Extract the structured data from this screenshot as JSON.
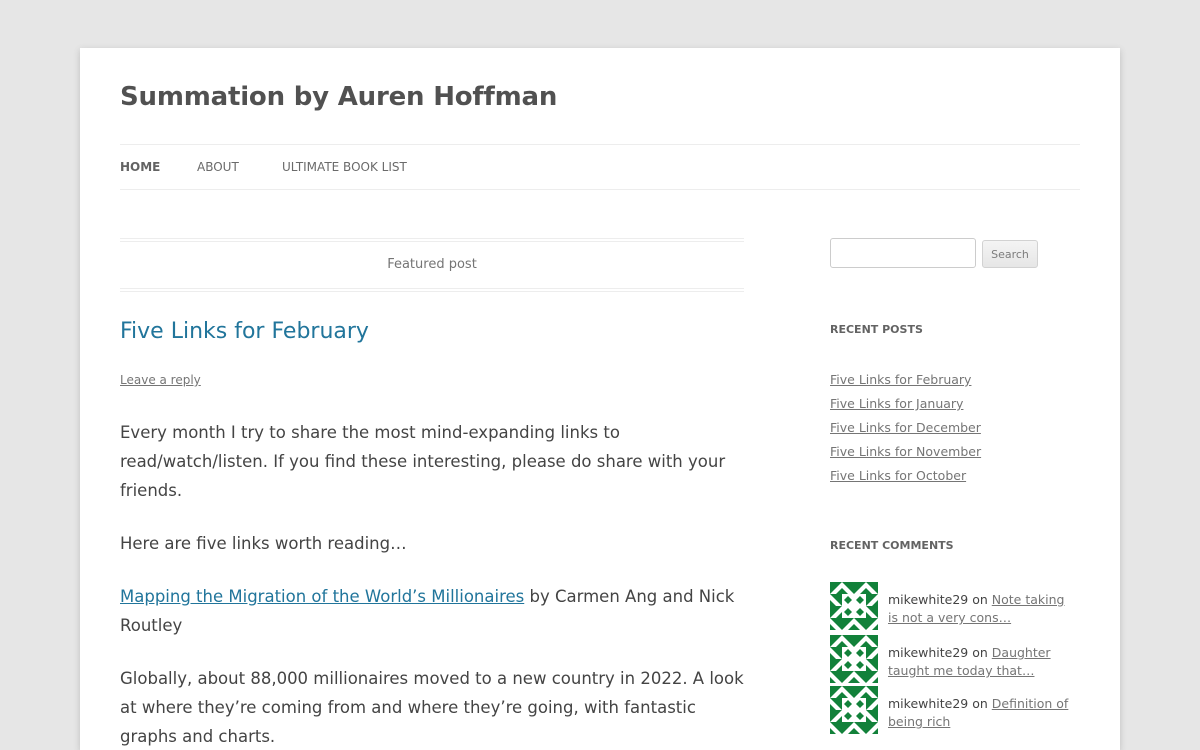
{
  "site": {
    "title": "Summation by Auren Hoffman"
  },
  "nav": {
    "items": [
      {
        "label": "Home"
      },
      {
        "label": "About"
      },
      {
        "label": "Ultimate Book List"
      }
    ]
  },
  "featured": {
    "label": "Featured post"
  },
  "post": {
    "title": "Five Links for February",
    "reply_label": "Leave a reply",
    "paragraph_1": "Every month I try to share the most mind-expanding links to read/watch/listen. If you find these interesting, please do share with your friends.",
    "paragraph_2": "Here are five links worth reading…",
    "link_1_title": "Mapping the Migration of the World’s Millionaires",
    "link_1_byline": " by Carmen Ang and Nick Routley",
    "paragraph_3": "Globally, about 88,000 millionaires moved to a new country in 2022. A look at where they’re coming from and where they’re going, with fantastic graphs and charts."
  },
  "sidebar": {
    "search": {
      "placeholder": "",
      "button_label": "Search"
    },
    "recent_posts": {
      "title": "Recent Posts",
      "items": [
        "Five Links for February",
        "Five Links for January",
        "Five Links for December",
        "Five Links for November",
        "Five Links for October"
      ]
    },
    "recent_comments": {
      "title": "Recent Comments",
      "items": [
        {
          "author": "mikewhite29",
          "on": " on ",
          "post": "Note taking is not a very cons…"
        },
        {
          "author": "mikewhite29",
          "on": " on ",
          "post": "Daughter taught me today that…"
        },
        {
          "author": "mikewhite29",
          "on": " on ",
          "post": "Definition of being rich"
        }
      ]
    }
  },
  "colors": {
    "background": "#e6e6e6",
    "link": "#21759b",
    "avatar": "#12813a"
  }
}
